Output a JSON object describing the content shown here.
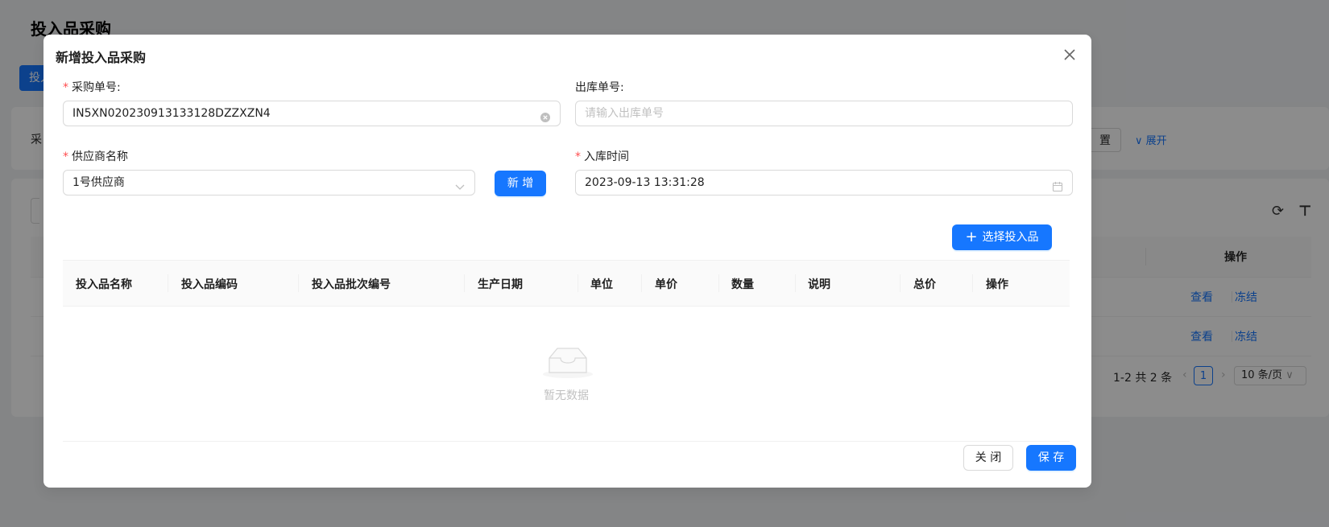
{
  "background": {
    "page_title": "投入品采购",
    "tab_button": "投入",
    "search_label": "采",
    "reset_label": "置",
    "expand_label": "展开",
    "table_header_op": "操作",
    "rows": [
      {
        "view": "查看",
        "freeze": "冻结"
      },
      {
        "view": "查看",
        "freeze": "冻结"
      }
    ],
    "pagination": {
      "total": "1-2 共 2 条",
      "page": "1",
      "page_size": "10 条/页"
    }
  },
  "modal": {
    "title": "新增投入品采购",
    "purchase_no": {
      "label": "采购单号:",
      "value": "IN5XN020230913133128DZZXZN4"
    },
    "outbound_no": {
      "label": "出库单号:",
      "placeholder": "请输入出库单号"
    },
    "supplier": {
      "label": "供应商名称",
      "value": "1号供应商"
    },
    "add_supplier_button": "新 增",
    "inbound_time": {
      "label": "入库时间",
      "value": "2023-09-13 13:31:28"
    },
    "select_input_button": "选择投入品",
    "table": {
      "columns": [
        "投入品名称",
        "投入品编码",
        "投入品批次编号",
        "生产日期",
        "单位",
        "单价",
        "数量",
        "说明",
        "总价",
        "操作"
      ],
      "empty_text": "暂无数据"
    },
    "footer": {
      "close_button": "关 闭",
      "save_button": "保 存"
    }
  },
  "colors": {
    "primary": "#1677ff",
    "required": "#ff4d4f",
    "mask": "rgba(0,0,0,0.45)"
  }
}
